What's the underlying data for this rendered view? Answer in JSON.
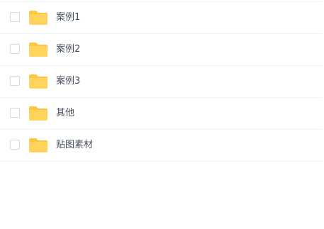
{
  "files": [
    {
      "name": "案例1",
      "icon": "folder-icon"
    },
    {
      "name": "案例2",
      "icon": "folder-icon"
    },
    {
      "name": "案例3",
      "icon": "folder-icon"
    },
    {
      "name": "其他",
      "icon": "folder-icon"
    },
    {
      "name": "贴图素材",
      "icon": "folder-icon"
    }
  ],
  "colors": {
    "folder_body": "#FFD35C",
    "folder_tab": "#FFC63D",
    "divider": "#F0F1F3",
    "text": "#454D5A",
    "checkbox_border": "#D6D9DE"
  }
}
